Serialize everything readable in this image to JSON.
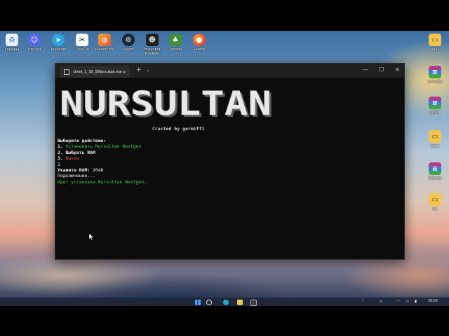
{
  "desktop": {
    "icons": [
      {
        "label": "Корзина"
      },
      {
        "label": "Discord"
      },
      {
        "label": "Telegram"
      },
      {
        "label": "CapCut"
      },
      {
        "label": "PlanetVPN"
      },
      {
        "label": "Steam"
      },
      {
        "label": "Buckshot Roulette"
      },
      {
        "label": "Terraria"
      },
      {
        "label": "Firefox"
      }
    ],
    "right_icons": [
      {
        "label": "video"
      },
      {
        "label": "www.zip"
      },
      {
        "label": "fucker"
      },
      {
        "label": "temp"
      },
      {
        "label": "Bellnee"
      },
      {
        "label": "tar"
      }
    ]
  },
  "window": {
    "tab_title": "client_1_16_5\\Nursultan.exe",
    "tab_close": "×",
    "new_tab": "+",
    "tab_dropdown": "⌄",
    "minimize": "—",
    "maximize": "☐",
    "close": "✕"
  },
  "terminal": {
    "banner_text": "NURSULTAN",
    "crafted_by": "Сrаctеd by germiff1",
    "lines": {
      "prompt": "Выберите действие:",
      "opt1_num": "1. ",
      "opt1_text": "Установить Nursultan Nextgen",
      "opt2_num": "2. ",
      "opt2_text": "Выбрать RAM",
      "opt3_num": "3. ",
      "opt3_text": "Выход",
      "input": "2",
      "ram_label": "Укажите RAM: ",
      "ram_value": "2048",
      "connecting": "Подключение...",
      "installing": "Идет установка Nursultan Nextgen.."
    }
  },
  "taskbar": {
    "clock_time": "16:25"
  }
}
